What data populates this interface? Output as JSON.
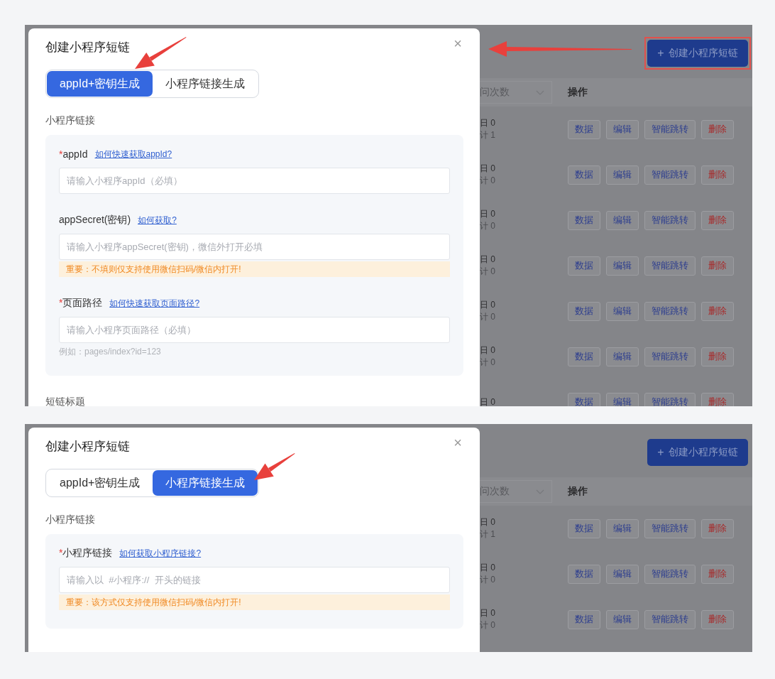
{
  "panels": [
    {
      "modal": {
        "title": "创建小程序短链",
        "close": "×",
        "tabs": [
          {
            "label": "appId+密钥生成",
            "selected": true
          },
          {
            "label": "小程序链接生成",
            "selected": false
          }
        ],
        "section_label": "小程序链接",
        "fields": [
          {
            "required_mark": "*",
            "label": "appId",
            "link": "如何快速获取appId?",
            "placeholder": "请输入小程序appId（必填）"
          },
          {
            "label": "appSecret(密钥)",
            "link": "如何获取?",
            "placeholder": "请输入小程序appSecret(密钥)，微信外打开必填",
            "warning": "重要：不填则仅支持使用微信扫码/微信内打开!"
          },
          {
            "required_mark": "*",
            "label": "页面路径",
            "link": "如何快速获取页面路径?",
            "placeholder": "请输入小程序页面路径（必填）",
            "hint": "例如：pages/index?id=123"
          }
        ],
        "next_section_label": "短链标题"
      },
      "background": {
        "create_button": {
          "icon": "+",
          "label": "创建小程序短链",
          "highlighted": true
        },
        "select_label": "问次数",
        "actions_header": "操作",
        "rows": [
          {
            "today": "日 0",
            "total": "计 1",
            "actions": [
              {
                "label": "数据",
                "kind": "normal"
              },
              {
                "label": "编辑",
                "kind": "normal"
              },
              {
                "label": "智能跳转",
                "kind": "normal"
              },
              {
                "label": "删除",
                "kind": "danger"
              }
            ]
          },
          {
            "today": "日 0",
            "total": "计 0",
            "actions": [
              {
                "label": "数据",
                "kind": "normal"
              },
              {
                "label": "编辑",
                "kind": "normal"
              },
              {
                "label": "智能跳转",
                "kind": "normal"
              },
              {
                "label": "删除",
                "kind": "danger"
              }
            ]
          },
          {
            "today": "日 0",
            "total": "计 0",
            "actions": [
              {
                "label": "数据",
                "kind": "normal"
              },
              {
                "label": "编辑",
                "kind": "normal"
              },
              {
                "label": "智能跳转",
                "kind": "normal"
              },
              {
                "label": "删除",
                "kind": "danger"
              }
            ]
          },
          {
            "today": "日 0",
            "total": "计 0",
            "actions": [
              {
                "label": "数据",
                "kind": "normal"
              },
              {
                "label": "编辑",
                "kind": "normal"
              },
              {
                "label": "智能跳转",
                "kind": "normal"
              },
              {
                "label": "删除",
                "kind": "danger"
              }
            ]
          },
          {
            "today": "日 0",
            "total": "计 0",
            "actions": [
              {
                "label": "数据",
                "kind": "normal"
              },
              {
                "label": "编辑",
                "kind": "normal"
              },
              {
                "label": "智能跳转",
                "kind": "normal"
              },
              {
                "label": "删除",
                "kind": "danger"
              }
            ]
          },
          {
            "today": "日 0",
            "total": "计 0",
            "actions": [
              {
                "label": "数据",
                "kind": "normal"
              },
              {
                "label": "编辑",
                "kind": "normal"
              },
              {
                "label": "智能跳转",
                "kind": "normal"
              },
              {
                "label": "删除",
                "kind": "danger"
              }
            ]
          },
          {
            "today": "日 0",
            "actions": [
              {
                "label": "数据",
                "kind": "normal"
              },
              {
                "label": "编辑",
                "kind": "normal"
              },
              {
                "label": "智能跳转",
                "kind": "normal"
              },
              {
                "label": "删除",
                "kind": "danger"
              }
            ]
          }
        ]
      },
      "annotations": [
        {
          "kind": "tab_arrow"
        },
        {
          "kind": "button_arrow"
        }
      ]
    },
    {
      "modal": {
        "title": "创建小程序短链",
        "close": "×",
        "tabs": [
          {
            "label": "appId+密钥生成",
            "selected": false
          },
          {
            "label": "小程序链接生成",
            "selected": true
          }
        ],
        "section_label": "小程序链接",
        "fields": [
          {
            "required_mark": "*",
            "label": "小程序链接",
            "link": "如何获取小程序链接?",
            "placeholder": "请输入以  #小程序://  开头的链接",
            "warning": "重要：该方式仅支持使用微信扫码/微信内打开!"
          }
        ]
      },
      "background": {
        "create_button": {
          "icon": "+",
          "label": "创建小程序短链",
          "highlighted": false
        },
        "select_label": "问次数",
        "actions_header": "操作",
        "rows": [
          {
            "today": "日 0",
            "total": "计 1",
            "actions": [
              {
                "label": "数据",
                "kind": "normal"
              },
              {
                "label": "编辑",
                "kind": "normal"
              },
              {
                "label": "智能跳转",
                "kind": "normal"
              },
              {
                "label": "删除",
                "kind": "danger"
              }
            ]
          },
          {
            "today": "日 0",
            "total": "计 0",
            "actions": [
              {
                "label": "数据",
                "kind": "normal"
              },
              {
                "label": "编辑",
                "kind": "normal"
              },
              {
                "label": "智能跳转",
                "kind": "normal"
              },
              {
                "label": "删除",
                "kind": "danger"
              }
            ]
          },
          {
            "today": "日 0",
            "total": "计 0",
            "actions": [
              {
                "label": "数据",
                "kind": "normal"
              },
              {
                "label": "编辑",
                "kind": "normal"
              },
              {
                "label": "智能跳转",
                "kind": "normal"
              },
              {
                "label": "删除",
                "kind": "danger"
              }
            ]
          }
        ]
      },
      "annotations": [
        {
          "kind": "tab_arrow"
        }
      ]
    }
  ]
}
